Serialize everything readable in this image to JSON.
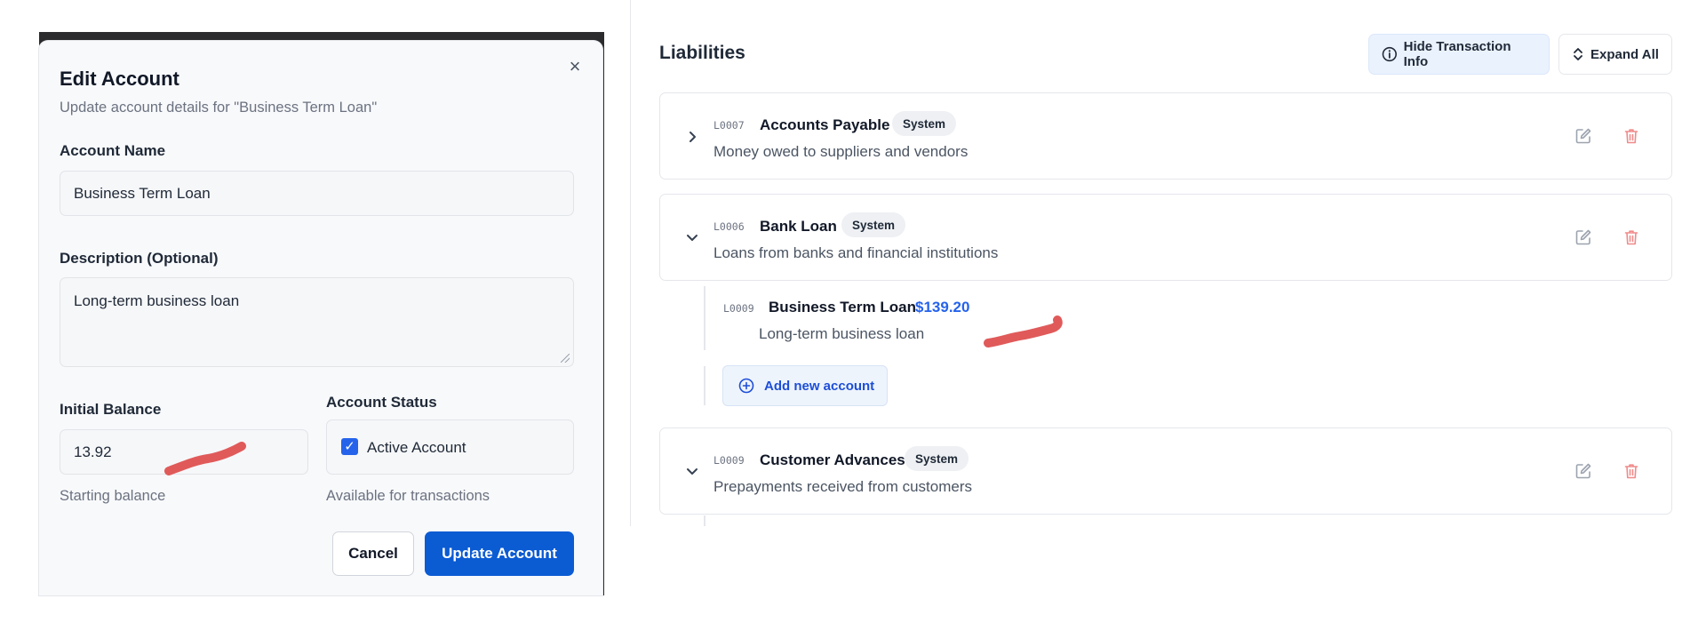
{
  "dialog": {
    "title": "Edit Account",
    "subtitle": "Update account details for \"Business Term Loan\"",
    "close_icon": "close-icon",
    "account_name": {
      "label": "Account Name",
      "value": "Business Term Loan"
    },
    "description": {
      "label": "Description (Optional)",
      "value": "Long-term business loan"
    },
    "initial_balance": {
      "label": "Initial Balance",
      "value": "13.92",
      "hint": "Starting balance"
    },
    "account_status": {
      "label": "Account Status",
      "checkbox_label": "Active Account",
      "checked": true,
      "hint": "Available for transactions"
    },
    "cancel_label": "Cancel",
    "update_label": "Update Account"
  },
  "liabilities": {
    "title": "Liabilities",
    "hide_info_label": "Hide Transaction Info",
    "expand_all_label": "Expand All",
    "accounts": [
      {
        "code": "L0007",
        "name": "Accounts Payable",
        "badge": "System",
        "description": "Money owed to suppliers and vendors",
        "expanded": false
      },
      {
        "code": "L0006",
        "name": "Bank Loan",
        "badge": "System",
        "description": "Loans from banks and financial institutions",
        "expanded": true,
        "children": [
          {
            "code": "L0009",
            "name": "Business Term Loan",
            "balance": "$139.20",
            "description": "Long-term business loan"
          }
        ],
        "add_label": "Add new account"
      },
      {
        "code": "L0009",
        "name": "Customer Advances",
        "badge": "System",
        "description": "Prepayments received from customers",
        "expanded": true
      }
    ]
  },
  "colors": {
    "primary": "#0b5bd3",
    "link": "#2563eb",
    "delete_icon": "#f08a8a",
    "annotation": "#e05a5a"
  }
}
